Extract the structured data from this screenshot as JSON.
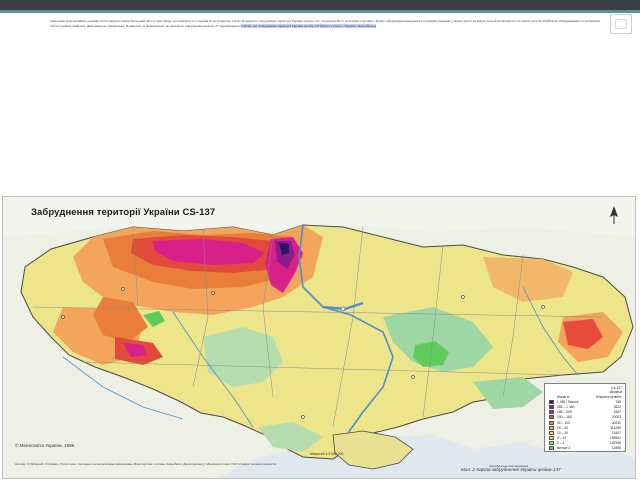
{
  "slide": {
    "intro_text": "Занесення радіоактивних речовин після аварії на Чорнобильській АЕС в атмосферу, розсіювання та осідання їх на поверхню землі сформувало забруднення території України цезієм-137, стронцієм-90 та ізотопами плутонію. Рівень забруднення визначався погодними умовами у перші дні після аварії, рельєфом місцевості та типом ґрунтів. Найбільш забрудненими стали північні області країни: Київська, Житомирська, Рівненська, Волинська та Чернігівська, де щільність забруднення цезієм-137 перевищувала",
    "intro_highlight": "5 Кі/кв. км. Забруднення території України цезієм-137 (Карта з атласу «Україна. Чорнобиль»)"
  },
  "map": {
    "title": "Забруднення території України CS-137",
    "scale_text": "Масштаб 1:3 500 000",
    "copyright": "© Мінгеосвіта України, 1996",
    "authors": "Автори: Л.Табачний, О.Кривко, Л.Костенко. Складено за матеріалами вимірювань Міністерства з питань Чорнобиля, Держгідромету, Мінагрополітики, НАН України та інших відомств",
    "caption": "Мал. 2 Карта забруднення України цезієм-137",
    "legend_note_top": "Щільність забруднення",
    "legend_note_side": "Чорнобильська зона відчуження",
    "legend": {
      "unit_header": "Cs-137",
      "unit_sub": "кБк/кв.м",
      "col_range": "кБк/кв.м",
      "col_count": "Кількість пунктів",
      "rows": [
        {
          "range": "1 480 і більше",
          "count": "766",
          "color": "#2c1462"
        },
        {
          "range": "555 – 1 480",
          "count": "3622",
          "color": "#8a1c8c"
        },
        {
          "range": "185 – 555",
          "count": "5367",
          "color": "#d4157a"
        },
        {
          "range": "100 – 185",
          "count": "20003",
          "color": "#e84a3c"
        },
        {
          "range": "40 – 100",
          "count": "40240",
          "color": "#f08c3c"
        },
        {
          "range": "20 – 40",
          "count": "114289",
          "color": "#f3b35a"
        },
        {
          "range": "10 – 20",
          "count": "1540?",
          "color": "#ecd85a"
        },
        {
          "range": "4 – 10",
          "count": "199661",
          "color": "#d9e08a"
        },
        {
          "range": "2 – 4",
          "count": "187956",
          "color": "#a8d8a0"
        },
        {
          "range": "менше 2",
          "count": "12896",
          "color": "#6ecb6a"
        }
      ]
    },
    "colors": {
      "background": "#f7f7f5",
      "neighbor_land": "#eef0e6",
      "base_low": "#ede58a",
      "light_green": "#9fd7a4",
      "bright_green": "#5ecb5a",
      "orange": "#f2a55b",
      "dark_orange": "#e87e3a",
      "red": "#e24a3b",
      "magenta": "#d81f8a",
      "purple": "#8a1c8c",
      "dark_purple": "#2c1462",
      "blue_water": "#4e8fd0",
      "border": "#4a4a4a"
    }
  }
}
